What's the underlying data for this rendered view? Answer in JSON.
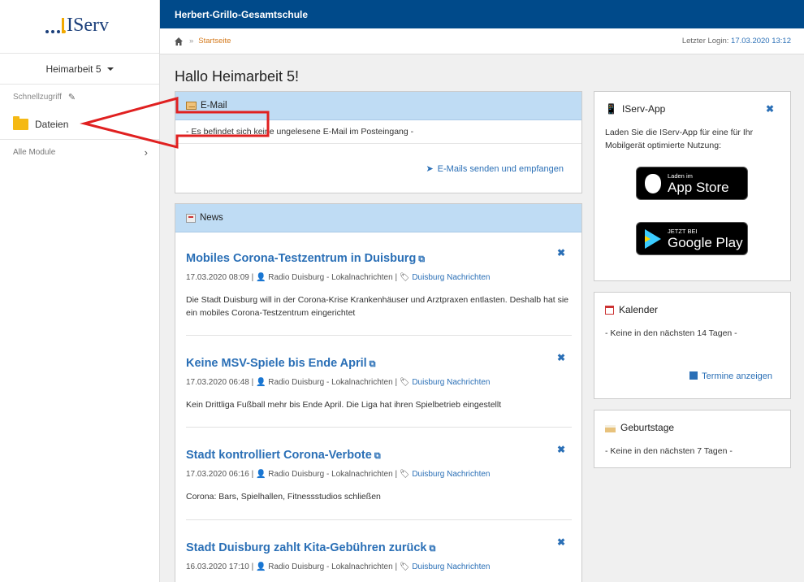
{
  "sidebar": {
    "logo_text": "IServ",
    "user": "Heimarbeit 5",
    "quick_access": "Schnellzugriff",
    "items": [
      {
        "label": "Dateien"
      }
    ],
    "all_modules": "Alle Module"
  },
  "header": {
    "school": "Herbert-Grillo-Gesamtschule",
    "breadcrumb_sep": "»",
    "breadcrumb": "Startseite",
    "last_login_label": "Letzter Login:",
    "last_login_value": "17.03.2020 13:12"
  },
  "page_title": "Hallo Heimarbeit 5!",
  "email": {
    "title": "E-Mail",
    "message": "- Es befindet sich keine ungelesene E-Mail im Posteingang -",
    "link": "E-Mails senden und empfangen"
  },
  "news": {
    "title": "News",
    "items": [
      {
        "title": "Mobiles Corona-Testzentrum in Duisburg",
        "date": "17.03.2020 08:09",
        "source": "Radio Duisburg - Lokalnachrichten",
        "tag": "Duisburg Nachrichten",
        "text": "Die Stadt Duisburg will in der Corona-Krise Krankenhäuser und Arztpraxen entlasten. Deshalb hat sie ein mobiles Corona-Testzentrum eingerichtet"
      },
      {
        "title": "Keine MSV-Spiele bis Ende April",
        "date": "17.03.2020 06:48",
        "source": "Radio Duisburg - Lokalnachrichten",
        "tag": "Duisburg Nachrichten",
        "text": "Kein Drittliga Fußball mehr bis Ende April. Die Liga hat ihren Spielbetrieb eingestellt"
      },
      {
        "title": "Stadt kontrolliert Corona-Verbote",
        "date": "17.03.2020 06:16",
        "source": "Radio Duisburg - Lokalnachrichten",
        "tag": "Duisburg Nachrichten",
        "text": "Corona: Bars, Spielhallen, Fitnessstudios schließen"
      },
      {
        "title": "Stadt Duisburg zahlt Kita-Gebühren zurück",
        "date": "16.03.2020 17:10",
        "source": "Radio Duisburg - Lokalnachrichten",
        "tag": "Duisburg Nachrichten",
        "text": ""
      }
    ]
  },
  "app": {
    "title": "IServ-App",
    "text": "Laden Sie die IServ-App für eine für Ihr Mobilgerät optimierte Nutzung:",
    "appstore_small": "Laden im",
    "appstore_big": "App Store",
    "play_small": "JETZT BEI",
    "play_big": "Google Play"
  },
  "calendar": {
    "title": "Kalender",
    "text": "- Keine in den nächsten 14 Tagen -",
    "link": "Termine anzeigen"
  },
  "birthdays": {
    "title": "Geburtstage",
    "text": "- Keine in den nächsten 7 Tagen -"
  },
  "colors": {
    "header": "#004a8a",
    "panel_head": "#bfdcf4",
    "link": "#2a6fb6",
    "arrow": "#e02020"
  }
}
